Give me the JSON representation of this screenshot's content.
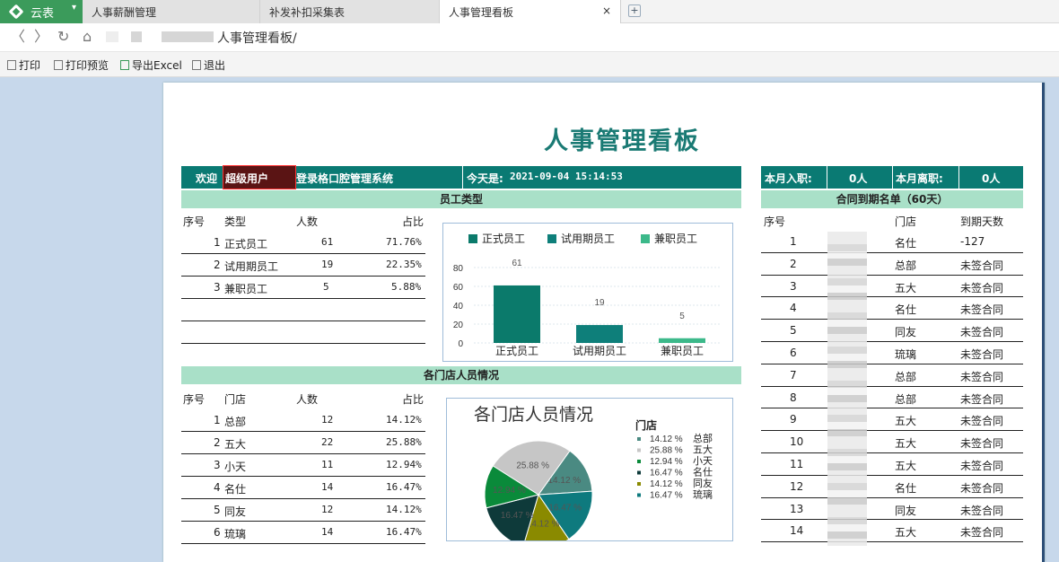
{
  "tabs": {
    "app_name": "云表",
    "items": [
      {
        "label": "人事薪酬管理"
      },
      {
        "label": "补发补扣采集表"
      },
      {
        "label": "人事管理看板",
        "close": "×"
      }
    ],
    "new_tab": "+"
  },
  "address": {
    "path": "人事管理看板/"
  },
  "toolbar": {
    "print": "打印",
    "preview": "打印预览",
    "export": "导出Excel",
    "exit": "退出"
  },
  "page": {
    "title": "人事管理看板"
  },
  "header": {
    "welcome": "欢迎",
    "user": "超级用户",
    "login_text": "登录格口腔管理系统",
    "today_label": "今天是:",
    "today_value": "2021-09-04 15:14:53",
    "month_join_label": "本月入职:",
    "month_join_value": "0人",
    "month_leave_label": "本月离职:",
    "month_leave_value": "0人"
  },
  "employee_types": {
    "section": "员工类型",
    "headers": [
      "序号",
      "类型",
      "人数",
      "占比"
    ],
    "rows": [
      {
        "no": "1",
        "type": "正式员工",
        "count": "61",
        "ratio": "71.76%"
      },
      {
        "no": "2",
        "type": "试用期员工",
        "count": "19",
        "ratio": "22.35%"
      },
      {
        "no": "3",
        "type": "兼职员工",
        "count": "5",
        "ratio": "5.88%"
      }
    ]
  },
  "stores": {
    "section": "各门店人员情况",
    "headers": [
      "序号",
      "门店",
      "人数",
      "占比"
    ],
    "rows": [
      {
        "no": "1",
        "store": "总部",
        "count": "12",
        "ratio": "14.12%"
      },
      {
        "no": "2",
        "store": "五大",
        "count": "22",
        "ratio": "25.88%"
      },
      {
        "no": "3",
        "store": "小天",
        "count": "11",
        "ratio": "12.94%"
      },
      {
        "no": "4",
        "store": "名仕",
        "count": "14",
        "ratio": "16.47%"
      },
      {
        "no": "5",
        "store": "同友",
        "count": "12",
        "ratio": "14.12%"
      },
      {
        "no": "6",
        "store": "琉璃",
        "count": "14",
        "ratio": "16.47%"
      }
    ]
  },
  "contracts": {
    "section": "合同到期名单（60天）",
    "headers": [
      "序号",
      "门店",
      "到期天数"
    ],
    "rows": [
      {
        "no": "1",
        "store": "名仕",
        "days": "-127"
      },
      {
        "no": "2",
        "store": "总部",
        "days": "未签合同"
      },
      {
        "no": "3",
        "store": "五大",
        "days": "未签合同"
      },
      {
        "no": "4",
        "store": "名仕",
        "days": "未签合同"
      },
      {
        "no": "5",
        "store": "同友",
        "days": "未签合同"
      },
      {
        "no": "6",
        "store": "琉璃",
        "days": "未签合同"
      },
      {
        "no": "7",
        "store": "总部",
        "days": "未签合同"
      },
      {
        "no": "8",
        "store": "总部",
        "days": "未签合同"
      },
      {
        "no": "9",
        "store": "五大",
        "days": "未签合同"
      },
      {
        "no": "10",
        "store": "五大",
        "days": "未签合同"
      },
      {
        "no": "11",
        "store": "五大",
        "days": "未签合同"
      },
      {
        "no": "12",
        "store": "名仕",
        "days": "未签合同"
      },
      {
        "no": "13",
        "store": "同友",
        "days": "未签合同"
      },
      {
        "no": "14",
        "store": "五大",
        "days": "未签合同"
      }
    ]
  },
  "chart_data": [
    {
      "type": "bar",
      "categories": [
        "正式员工",
        "试用期员工",
        "兼职员工"
      ],
      "values": [
        61,
        19,
        5
      ],
      "legend": [
        "正式员工",
        "试用期员工",
        "兼职员工"
      ],
      "legend_position": "top",
      "colors": [
        "#0b7a6b",
        "#0e7f7a",
        "#3cb98a"
      ],
      "ylim": [
        0,
        80
      ],
      "yticks": [
        0,
        20,
        40,
        60,
        80
      ],
      "grid": true
    },
    {
      "type": "pie",
      "title": "各门店人员情况",
      "legend_title": "门店",
      "legend_position": "right",
      "labels": [
        "总部",
        "五大",
        "小天",
        "名仕",
        "同友",
        "琉璃"
      ],
      "values": [
        14.12,
        25.88,
        12.94,
        16.47,
        14.12,
        16.47
      ],
      "value_labels": [
        "14.12 %",
        "25.88 %",
        "12.94 %",
        "16.47 %",
        "14.12 %",
        "16.47 %"
      ],
      "colors": [
        "#4a8a82",
        "#c6c6c6",
        "#0a8a3a",
        "#0e3a3a",
        "#8a8a00",
        "#0e7a7e"
      ]
    }
  ]
}
